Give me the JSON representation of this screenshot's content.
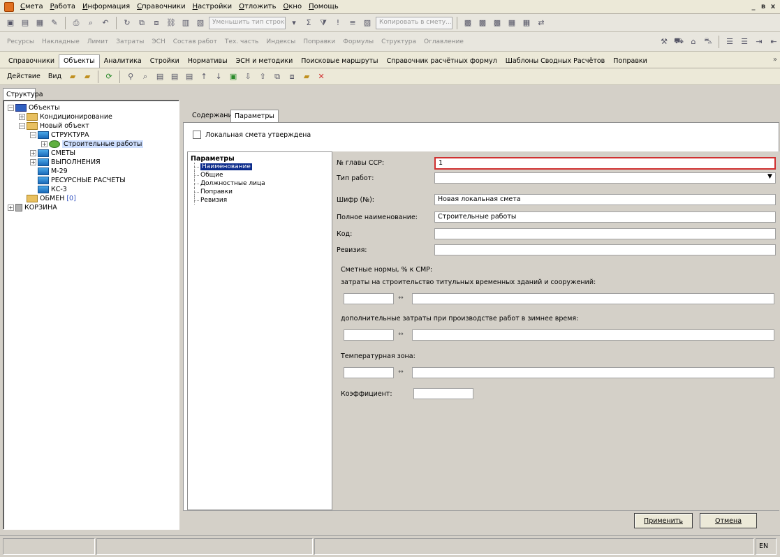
{
  "menu": {
    "items": [
      "Смета",
      "Работа",
      "Информация",
      "Справочники",
      "Настройки",
      "Отложить",
      "Окно",
      "Помощь"
    ],
    "window_controls": [
      "_",
      "в",
      "x"
    ]
  },
  "toolbar1": {
    "combo1": "Уменьшить тип строки...",
    "combo2": "Копировать в смету..."
  },
  "toolbar2": {
    "items": [
      "Ресурсы",
      "Накладные",
      "Лимит",
      "Затраты",
      "ЭСН",
      "Состав работ",
      "Тех. часть",
      "Индексы",
      "Поправки",
      "Формулы",
      "Структура",
      "Оглавление"
    ]
  },
  "module_tabs": {
    "items": [
      "Справочники",
      "Объекты",
      "Аналитика",
      "Стройки",
      "Нормативы",
      "ЭСН и методики",
      "Поисковые маршруты",
      "Справочник расчётных формул",
      "Шаблоны Сводных Расчётов",
      "Поправки"
    ],
    "active": "Объекты",
    "more": "»"
  },
  "actionbar": {
    "action": "Действие",
    "view": "Вид"
  },
  "left_panel": {
    "tab": "Структура",
    "tree": {
      "root": "Объекты",
      "conditioning": "Кондиционирование",
      "new_object": "Новый объект",
      "structure": "СТРУКТУРА",
      "construction_works": "Строительные работы",
      "estimates": "СМЕТЫ",
      "executions": "ВЫПОЛНЕНИЯ",
      "m29": "М-29",
      "resource_calcs": "РЕСУРСНЫЕ РАСЧЕТЫ",
      "ks3": "КС-3",
      "exchange": "ОБМЕН",
      "exchange_count": "[0]",
      "trash": "КОРЗИНА"
    }
  },
  "right_panel": {
    "tabs": [
      "Содержание",
      "Параметры"
    ],
    "active_tab": "Параметры",
    "approved_checkbox": {
      "label": "Локальная смета утверждена",
      "checked": false
    },
    "params_list": {
      "root": "Параметры",
      "items": [
        "Наименование",
        "Общие",
        "Должностные лица",
        "Поправки",
        "Ревизия"
      ],
      "active": "Наименование"
    },
    "form": {
      "ssr_chapter_label": "№ главы ССР:",
      "ssr_chapter_value": "1",
      "work_type_label": "Тип работ:",
      "work_type_value": "",
      "code_label": "Шифр (№):",
      "code_value": "Новая локальная смета",
      "full_name_label": "Полное наименование:",
      "full_name_value": "Строительные работы",
      "kod_label": "Код:",
      "kod_value": "",
      "revision_label": "Ревизия:",
      "revision_value": "",
      "norms_header": "Сметные нормы, % к СМР:",
      "temp_buildings_label": "затраты на строительство титульных временных зданий и сооружений:",
      "winter_label": "дополнительные затраты при производстве работ в зимнее время:",
      "temp_zone_label": "Температурная зона:",
      "coef_label": "Коэффициент:",
      "spinner_glyph": "↔"
    },
    "buttons": {
      "apply": "Применить",
      "cancel": "Отмена"
    }
  },
  "status": {
    "lang": "EN"
  }
}
